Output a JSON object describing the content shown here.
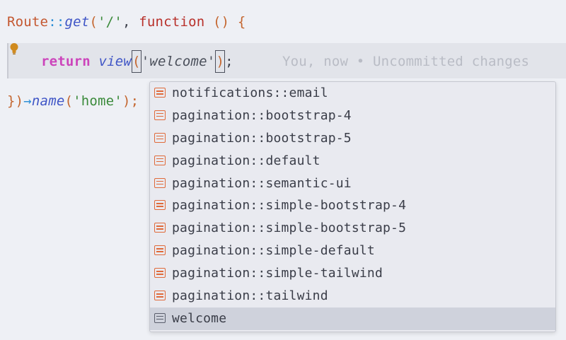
{
  "editor": {
    "line1": {
      "route": "Route",
      "sep": "::",
      "get": "get",
      "open": "(",
      "arg": "'/'",
      "comma": ", ",
      "function_kw": "function",
      "params": " () {"
    },
    "line2": {
      "return_kw": "return",
      "view": "view",
      "open": "(",
      "arg": "'welcome'",
      "close": ")",
      "semi": ";"
    },
    "line3": {
      "close": "})",
      "arrow": "→",
      "name": "name",
      "open": "(",
      "arg": "'home'",
      "close2": ");"
    },
    "blame": "You, now • Uncommitted changes",
    "icons": {
      "bulb": "lightbulb-icon",
      "item": "symbol-text-icon"
    },
    "colors": {
      "accent_orange": "#e06a3a",
      "bulb": "#d08a1e",
      "selection": "#cfd2dc"
    }
  },
  "completion": {
    "items": [
      {
        "label": "notifications::email"
      },
      {
        "label": "pagination::bootstrap-4"
      },
      {
        "label": "pagination::bootstrap-5"
      },
      {
        "label": "pagination::default"
      },
      {
        "label": "pagination::semantic-ui"
      },
      {
        "label": "pagination::simple-bootstrap-4"
      },
      {
        "label": "pagination::simple-bootstrap-5"
      },
      {
        "label": "pagination::simple-default"
      },
      {
        "label": "pagination::simple-tailwind"
      },
      {
        "label": "pagination::tailwind"
      },
      {
        "label": "welcome"
      }
    ],
    "selected_index": 10
  }
}
